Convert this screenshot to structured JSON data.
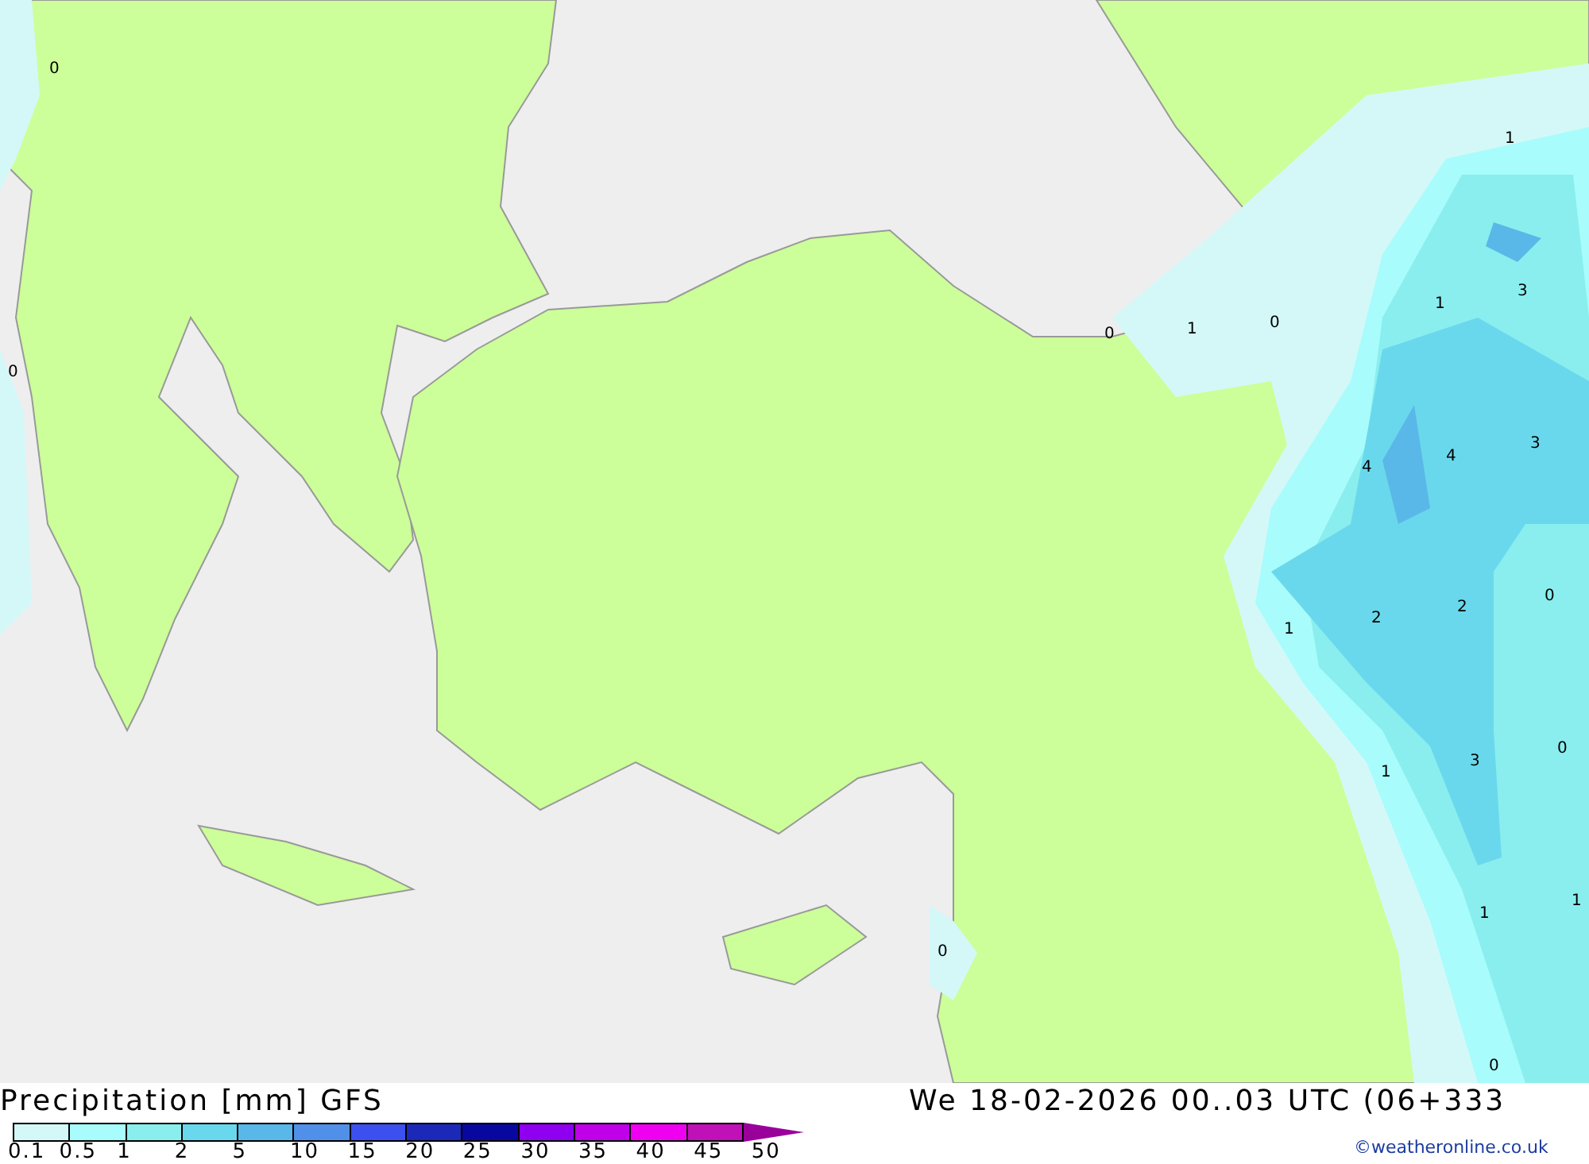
{
  "map": {
    "contour_labels": [
      "0",
      "0",
      "0",
      "1",
      "0",
      "1",
      "3",
      "1",
      "4",
      "4",
      "3",
      "0",
      "1",
      "2",
      "2",
      "0",
      "1",
      "3",
      "1",
      "1",
      "0",
      "0"
    ]
  },
  "legend": {
    "title": "Precipitation [mm] GFS",
    "valid_time": "We 18-02-2026 00..03 UTC (06+333",
    "credit": "©weatheronline.co.uk",
    "swatches": [
      {
        "color": "#d4f8f8"
      },
      {
        "color": "#a8fcfc"
      },
      {
        "color": "#8aeeee"
      },
      {
        "color": "#6ad8ec"
      },
      {
        "color": "#5ab8e8"
      },
      {
        "color": "#5090e8"
      },
      {
        "color": "#3c50f0"
      },
      {
        "color": "#1c28b8"
      },
      {
        "color": "#0808a0"
      },
      {
        "color": "#9000f0"
      },
      {
        "color": "#c000e8"
      },
      {
        "color": "#f000f0"
      },
      {
        "color": "#c010b8"
      },
      {
        "color": "#9a009a",
        "kind": "arrow"
      }
    ],
    "ticks": [
      "0.1",
      "0.5",
      "1",
      "2",
      "5",
      "10",
      "15",
      "20",
      "25",
      "30",
      "35",
      "40",
      "45",
      "50"
    ]
  }
}
